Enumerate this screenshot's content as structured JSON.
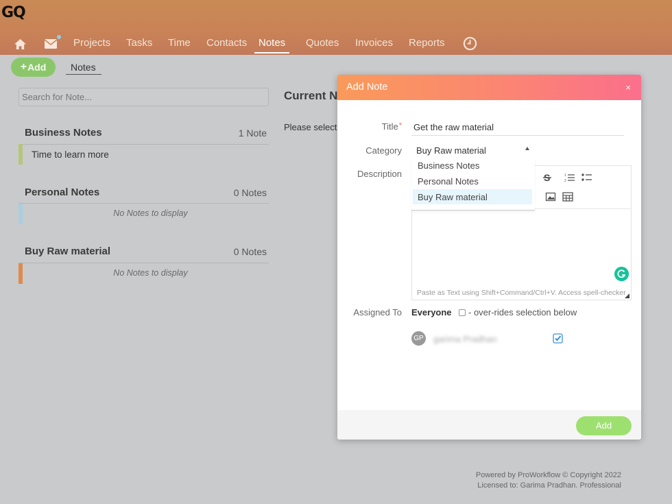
{
  "app": {
    "logo": "GQ"
  },
  "nav": {
    "items": [
      {
        "label": "Projects"
      },
      {
        "label": "Tasks"
      },
      {
        "label": "Time"
      },
      {
        "label": "Contacts"
      },
      {
        "label": "Notes",
        "active": true
      },
      {
        "label": "Quotes"
      },
      {
        "label": "Invoices"
      },
      {
        "label": "Reports"
      }
    ],
    "icons": [
      "home-icon",
      "mail-icon",
      "clock-icon"
    ]
  },
  "toolbar": {
    "add_label": "Add",
    "notes_tab": "Notes"
  },
  "search": {
    "placeholder": "Search for Note..."
  },
  "groups": [
    {
      "title": "Business Notes",
      "count": "1 Note",
      "color": "#b3c67a",
      "notes": [
        "Time to learn more"
      ],
      "empty_text": ""
    },
    {
      "title": "Personal Notes",
      "count": "0 Notes",
      "color": "#a9cfe0",
      "notes": [],
      "empty_text": "No Notes to display"
    },
    {
      "title": "Buy Raw material",
      "count": "0 Notes",
      "color": "#e08a4e",
      "notes": [],
      "empty_text": "No Notes to display"
    }
  ],
  "current": {
    "title": "Current N",
    "message": "Please select"
  },
  "modal": {
    "title": "Add Note",
    "close": "×",
    "labels": {
      "title": "Title",
      "required": "*",
      "category": "Category",
      "description": "Description",
      "assigned_to": "Assigned To"
    },
    "title_value": "Get the raw material",
    "category_value": "Buy Raw material",
    "category_options": [
      "Business Notes",
      "Personal Notes",
      "Buy Raw material"
    ],
    "editor_hint": "Paste as Text using Shift+Command/Ctrl+V. Access spell-checker",
    "editor_icons": [
      "strikethrough-icon",
      "ordered-list-icon",
      "unordered-list-icon",
      "image-icon",
      "table-icon"
    ],
    "everyone": "Everyone",
    "override_label": "- over-rides selection below",
    "user": {
      "initials": "GP",
      "name": "garima Pradhan",
      "checked": true
    },
    "add_button": "Add",
    "accent": "#fb8572"
  },
  "footer": {
    "line1": "Powered by ProWorkflow © Copyright 2022",
    "line2": "Licensed to: Garima Pradhan. Professional"
  }
}
